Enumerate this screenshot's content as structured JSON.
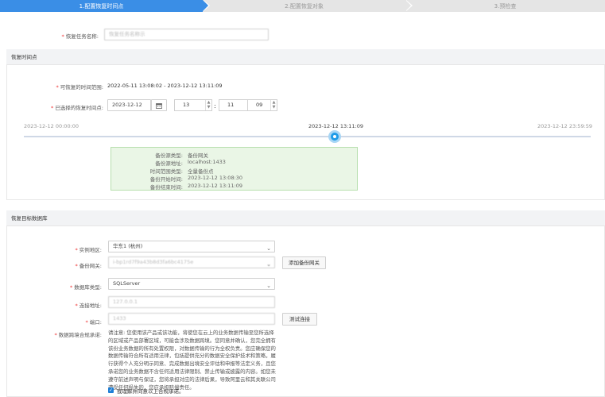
{
  "steps": [
    {
      "label": "1.配置恢复时间点"
    },
    {
      "label": "2.配置恢复对象"
    },
    {
      "label": "3.预检查"
    }
  ],
  "task_name": {
    "label": "恢复任务名称:",
    "value": "恢复任务名称示"
  },
  "restore_point_section": {
    "title": "恢复时间点"
  },
  "restorable_range": {
    "label": "可恢复的时间范围:",
    "value": "2022-05-11 13:08:02 - 2023-12-12 13:11:09"
  },
  "selected_point": {
    "label": "已选择的恢复时间点:",
    "date": "2023-12-12",
    "hour": "13",
    "minute": "11",
    "second": "09",
    "sep": ":"
  },
  "timeline": {
    "start": "2023-12-12 00:00:00",
    "current": "2023-12-12 13:11:09",
    "end": "2023-12-12 23:59:59",
    "current_position": 0.549
  },
  "backup_info": [
    {
      "key": "备份源类型:",
      "value": "备份网关"
    },
    {
      "key": "备份源地址:",
      "value": "localhost:1433"
    },
    {
      "key": "时间范围类型:",
      "value": "全量备份点"
    },
    {
      "key": "备份开始时间:",
      "value": "2023-12-12 13:08:30"
    },
    {
      "key": "备份结束时间:",
      "value": "2023-12-12 13:11:09"
    }
  ],
  "target_section": {
    "title": "恢复目标数据库"
  },
  "instance_region": {
    "label": "实例地区:",
    "value": "华东1 (杭州)"
  },
  "backup_gateway": {
    "label": "备份网关:",
    "value": "i-bp1rd7f9a43b8d3fa6bc4175e",
    "add_button": "添加备份网关"
  },
  "db_type": {
    "label": "数据库类型:",
    "value": "SQLServer"
  },
  "conn_addr": {
    "label": "连接地址:",
    "value": "127.0.0.1"
  },
  "port": {
    "label": "端口:",
    "value": "1433",
    "test_button": "测试连接"
  },
  "compliance": {
    "label": "数据跨境合规承诺:",
    "text": "请注意: 您使用该产品或该功能，将使您在云上的业务数据传输至您所选择的区域或产品部署区域，可能会涉及数据跨境。您同意并确认，您完全拥有该份业务数据的所有处置权限，对数据传输的行为全权负责。您应确保您的数据传输符合所有适用法律，包括提供充分的数据安全保护技术和策略，履行获得个人充分明示同意、完成数据出境安全评估和申报等法定义务，且您承诺您的业务数据不含任何适用法律限制、禁止传输或披露的内容。如您未遵守前述声明与保证，您将承担对应的法律后果，导致阿里云和其关联公司遭受任何损失的，您应承担赔偿责任。",
    "checkbox_label": "我理解并同意以上合规承诺。"
  },
  "colors": {
    "accent": "#3a8ee6",
    "knob": "#1e9be8",
    "info_bg": "#eaf6e6",
    "required": "#ee3333"
  }
}
